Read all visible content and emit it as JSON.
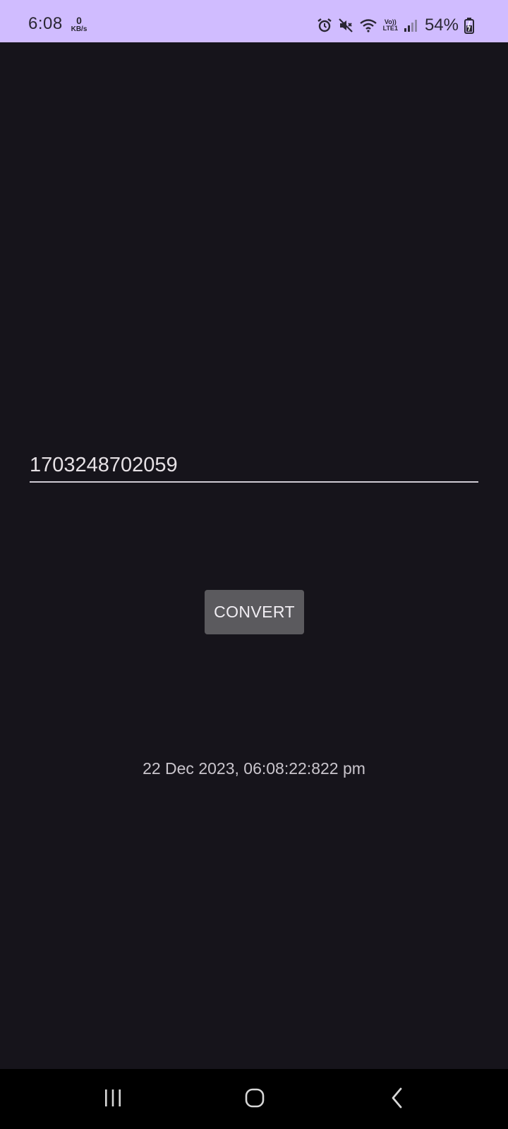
{
  "status_bar": {
    "time": "6:08",
    "net_speed_value": "0",
    "net_speed_unit": "KB/s",
    "volte_top": "Vo))",
    "volte_bottom": "LTE1",
    "battery_percent": "54%",
    "icons": [
      "alarm-icon",
      "mute-icon",
      "wifi-icon",
      "volte-icon",
      "signal-icon",
      "battery-icon"
    ],
    "background_color": "#d0bcff"
  },
  "converter": {
    "timestamp_value": "1703248702059",
    "convert_label": "CONVERT",
    "result": "22 Dec 2023, 06:08:22:822 pm"
  },
  "nav_bar": {
    "icons": [
      "recent-apps-icon",
      "home-icon",
      "back-icon"
    ]
  },
  "colors": {
    "background": "#16141b",
    "button": "#5b5a5e",
    "text": "#e6e1e5"
  }
}
